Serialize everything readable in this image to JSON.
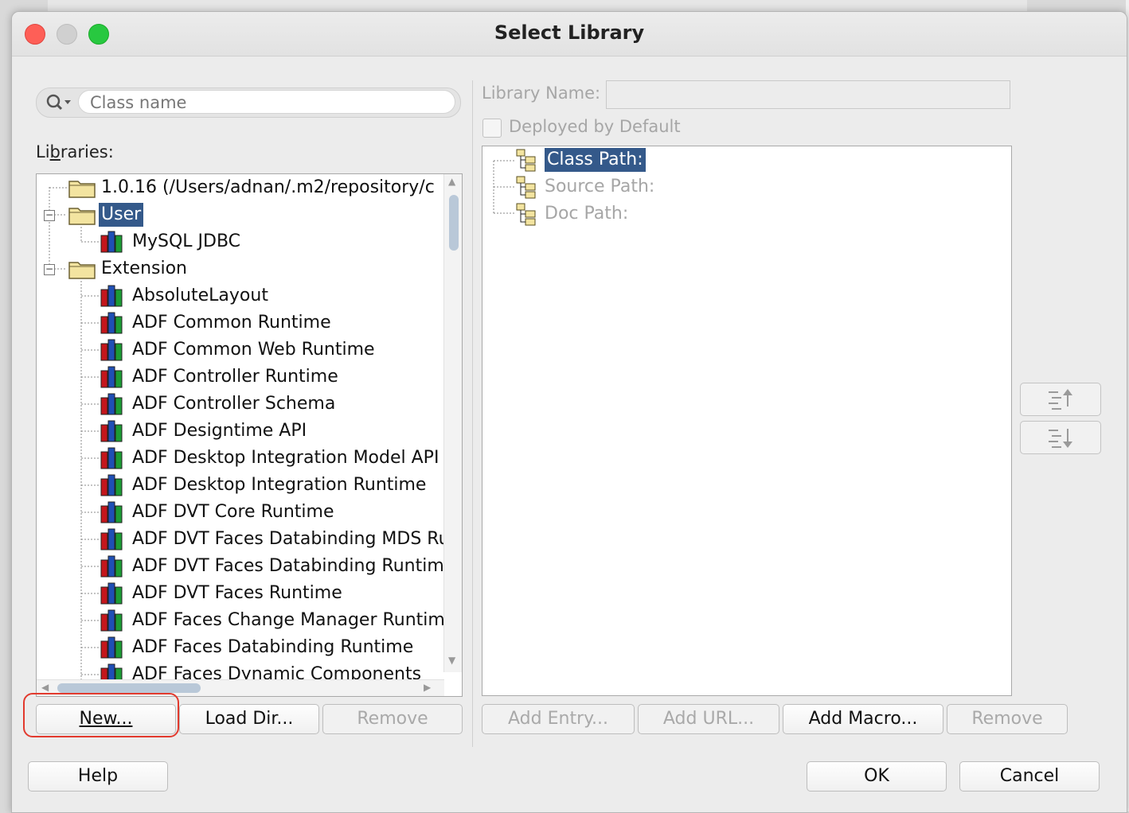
{
  "window": {
    "title": "Select Library"
  },
  "search": {
    "placeholder": "Class name"
  },
  "left": {
    "libraries_label": "Libraries:",
    "tree": {
      "root_entry": "1.0.16 (/Users/adnan/.m2/repository/c",
      "user_group": {
        "label": "User",
        "items": [
          "MySQL JDBC"
        ]
      },
      "extension_group": {
        "label": "Extension",
        "items": [
          "AbsoluteLayout",
          "ADF Common Runtime",
          "ADF Common Web Runtime",
          "ADF Controller Runtime",
          "ADF Controller Schema",
          "ADF Designtime API",
          "ADF Desktop Integration Model API",
          "ADF Desktop Integration Runtime",
          "ADF DVT Core Runtime",
          "ADF DVT Faces Databinding MDS Rui",
          "ADF DVT Faces Databinding Runtime",
          "ADF DVT Faces Runtime",
          "ADF Faces Change Manager Runtime",
          "ADF Faces Databinding Runtime",
          "ADF Faces Dynamic Components"
        ]
      }
    },
    "buttons": {
      "new": "New...",
      "load_dir": "Load Dir...",
      "remove": "Remove"
    }
  },
  "right": {
    "library_name_label": "Library Name:",
    "library_name_value": "",
    "deployed_by_default_label": "Deployed by Default",
    "deployed_by_default_checked": false,
    "paths": [
      "Class Path:",
      "Source Path:",
      "Doc Path:"
    ],
    "selected_path": "Class Path:",
    "buttons": {
      "add_entry": "Add Entry...",
      "add_url": "Add URL...",
      "add_macro": "Add Macro...",
      "remove": "Remove"
    }
  },
  "footer": {
    "help": "Help",
    "ok": "OK",
    "cancel": "Cancel"
  },
  "colors": {
    "selection": "#34598a",
    "highlight_ring": "#e23a2e",
    "close": "#fe5f57",
    "zoom": "#28c840"
  },
  "icons": [
    "search-icon",
    "folder-icon",
    "library-books-icon",
    "path-tree-icon",
    "move-up-icon",
    "move-down-icon"
  ]
}
